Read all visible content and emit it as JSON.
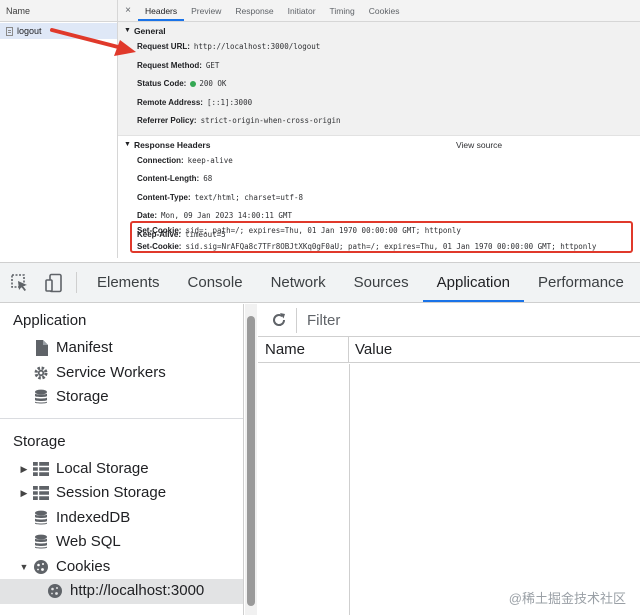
{
  "network": {
    "list_header": "Name",
    "request_name": "logout",
    "tabs": [
      "Headers",
      "Preview",
      "Response",
      "Initiator",
      "Timing",
      "Cookies"
    ],
    "close_glyph": "×",
    "general": {
      "title": "General",
      "rows": [
        {
          "key": "Request URL:",
          "value": "http://localhost:3000/logout"
        },
        {
          "key": "Request Method:",
          "value": "GET"
        },
        {
          "key": "Status Code:",
          "value": "200 OK"
        },
        {
          "key": "Remote Address:",
          "value": "[::1]:3000"
        },
        {
          "key": "Referrer Policy:",
          "value": "strict-origin-when-cross-origin"
        }
      ]
    },
    "response_headers": {
      "title": "Response Headers",
      "view_source": "View source",
      "rows": [
        {
          "key": "Connection:",
          "value": "keep-alive"
        },
        {
          "key": "Content-Length:",
          "value": "68"
        },
        {
          "key": "Content-Type:",
          "value": "text/html; charset=utf-8"
        },
        {
          "key": "Date:",
          "value": "Mon, 09 Jan 2023 14:00:11 GMT"
        },
        {
          "key": "Keep-Alive:",
          "value": "timeout=5"
        }
      ],
      "set_cookie_rows": [
        {
          "key": "Set-Cookie:",
          "value": "sid=; path=/; expires=Thu, 01 Jan 1970 00:00:00 GMT; httponly"
        },
        {
          "key": "Set-Cookie:",
          "value": "sid.sig=NrAFQa8c7TFr8OBJtXKq0gF0aU; path=/; expires=Thu, 01 Jan 1970 00:00:00 GMT; httponly"
        }
      ]
    },
    "colors": {
      "highlight_border": "#e0392b",
      "status_ok": "#34a853"
    }
  },
  "devtools": {
    "tabs": [
      "Elements",
      "Console",
      "Network",
      "Sources",
      "Application",
      "Performance"
    ],
    "active_tab": "Application",
    "sidebar": {
      "application_title": "Application",
      "application_items": [
        {
          "label": "Manifest",
          "icon": "file-icon"
        },
        {
          "label": "Service Workers",
          "icon": "gear-icon"
        },
        {
          "label": "Storage",
          "icon": "database-icon"
        }
      ],
      "storage_title": "Storage",
      "storage_items": [
        {
          "label": "Local Storage",
          "icon": "grid-icon",
          "expand": "▶"
        },
        {
          "label": "Session Storage",
          "icon": "grid-icon",
          "expand": "▶"
        },
        {
          "label": "IndexedDB",
          "icon": "database-icon",
          "expand": ""
        },
        {
          "label": "Web SQL",
          "icon": "database-icon",
          "expand": ""
        },
        {
          "label": "Cookies",
          "icon": "cookie-icon",
          "expand": "▼"
        }
      ],
      "cookie_origin": "http://localhost:3000"
    },
    "toolbar": {
      "filter_placeholder": "Filter"
    },
    "grid": {
      "columns": [
        "Name",
        "Value"
      ]
    },
    "watermark": "@稀土掘金技术社区"
  }
}
